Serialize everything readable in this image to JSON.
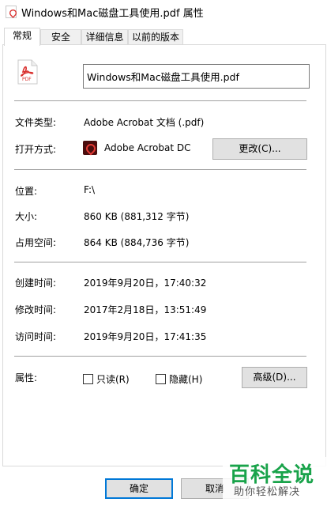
{
  "window": {
    "title": "Windows和Mac磁盘工具使用.pdf 属性"
  },
  "tabs": [
    {
      "label": "常规"
    },
    {
      "label": "安全"
    },
    {
      "label": "详细信息"
    },
    {
      "label": "以前的版本"
    }
  ],
  "general": {
    "filename": "Windows和Mac磁盘工具使用.pdf",
    "file_type_label": "文件类型:",
    "file_type_value": "Adobe Acrobat 文档 (.pdf)",
    "open_with_label": "打开方式:",
    "open_with_value": "Adobe Acrobat DC",
    "change_button": "更改(C)...",
    "location_label": "位置:",
    "location_value": "F:\\",
    "size_label": "大小:",
    "size_value": "860 KB (881,312 字节)",
    "size_on_disk_label": "占用空间:",
    "size_on_disk_value": "864 KB (884,736 字节)",
    "created_label": "创建时间:",
    "created_value": "2019年9月20日，17:40:32",
    "modified_label": "修改时间:",
    "modified_value": "2017年2月18日，13:51:49",
    "accessed_label": "访问时间:",
    "accessed_value": "2019年9月20日，17:41:35",
    "attributes_label": "属性:",
    "readonly_label": "只读(R)",
    "hidden_label": "隐藏(H)",
    "advanced_button": "高级(D)..."
  },
  "footer": {
    "ok_button": "确定",
    "cancel_button": "取消"
  },
  "watermark": {
    "title": "百科全说",
    "subtitle": "助你轻松解决"
  },
  "colors": {
    "pdf_red": "#d9302e",
    "button_bg": "#e1e1e1",
    "focus_blue": "#0078d7",
    "watermark_green": "#19a34a"
  },
  "icons": {
    "title_icon": "pdf-file-icon",
    "file_icon": "pdf-file-icon",
    "app_icon": "adobe-acrobat-icon"
  }
}
